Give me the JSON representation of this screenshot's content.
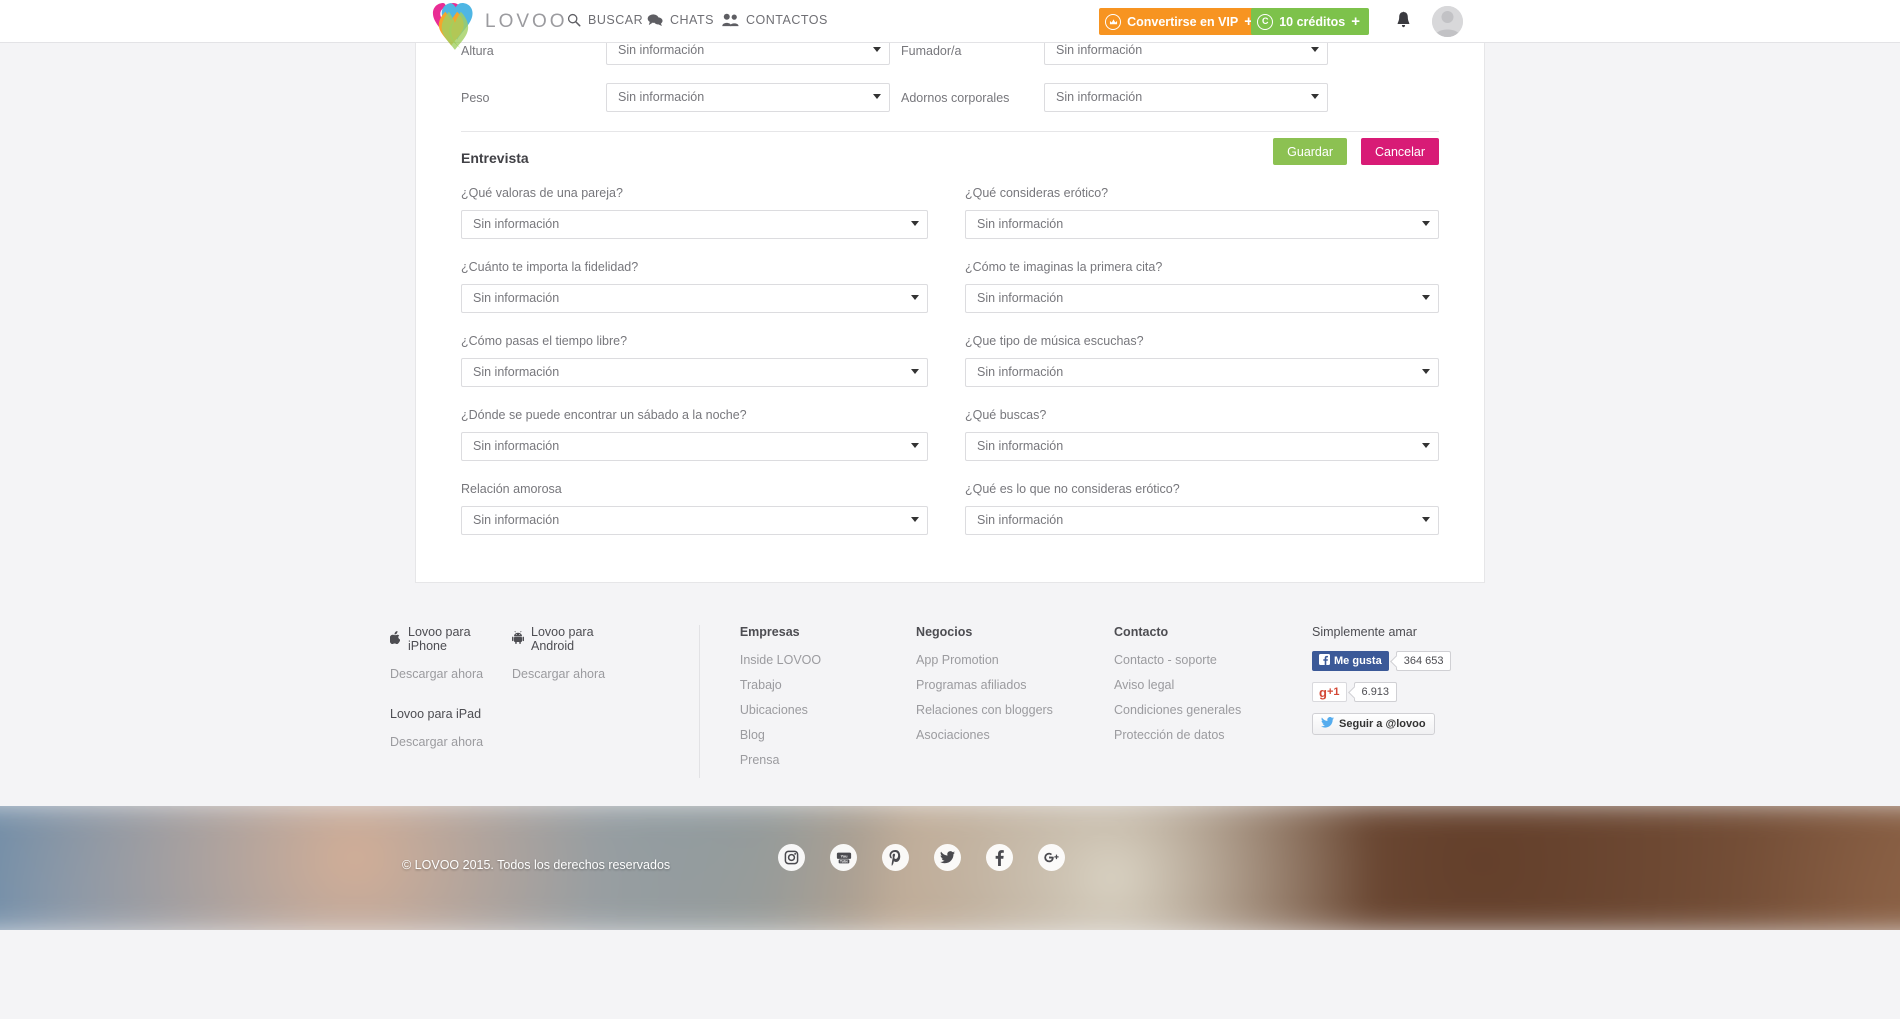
{
  "header": {
    "brand": "LOVOO",
    "nav": [
      {
        "label": "BUSCAR",
        "icon": "search-icon"
      },
      {
        "label": "CHATS",
        "icon": "chat-icon"
      },
      {
        "label": "CONTACTOS",
        "icon": "contacts-icon"
      }
    ],
    "vip_button": {
      "label": "Convertirse en VIP",
      "plus": "+",
      "color": "#f79421"
    },
    "credits_button": {
      "label": "10 créditos",
      "badge": "C",
      "plus": "+",
      "color": "#7dc24b"
    },
    "bell": "notifications-bell",
    "avatar": "user-avatar"
  },
  "top_fields": [
    {
      "label": "Altura",
      "value": "Sin información"
    },
    {
      "label": "Fumador/a",
      "value": "Sin información"
    },
    {
      "label": "Peso",
      "value": "Sin información"
    },
    {
      "label": "Adornos corporales",
      "value": "Sin información"
    }
  ],
  "interview": {
    "title": "Entrevista",
    "save_label": "Guardar",
    "cancel_label": "Cancelar",
    "save_color": "#8cc152",
    "cancel_color": "#d81b76",
    "placeholder": "Sin información",
    "questions": [
      {
        "label": "¿Qué valoras de una pareja?",
        "value": "Sin información"
      },
      {
        "label": "¿Qué consideras erótico?",
        "value": "Sin información"
      },
      {
        "label": "¿Cuánto te importa la fidelidad?",
        "value": "Sin información"
      },
      {
        "label": "¿Cómo te imaginas la primera cita?",
        "value": "Sin información"
      },
      {
        "label": "¿Cómo pasas el tiempo libre?",
        "value": "Sin información"
      },
      {
        "label": "¿Que tipo de música escuchas?",
        "value": "Sin información"
      },
      {
        "label": "¿Dónde se puede encontrar un sábado a la noche?",
        "value": "Sin información"
      },
      {
        "label": "¿Qué buscas?",
        "value": "Sin información"
      },
      {
        "label": "Relación amorosa",
        "value": "Sin información"
      },
      {
        "label": "¿Qué es lo que no consideras erótico?",
        "value": "Sin información"
      }
    ]
  },
  "footer": {
    "apps": {
      "iphone": {
        "title": "Lovoo para iPhone",
        "sub": "Descargar ahora",
        "icon": "apple-icon"
      },
      "android": {
        "title": "Lovoo para Android",
        "sub": "Descargar ahora",
        "icon": "android-icon"
      },
      "ipad": {
        "title": "Lovoo para iPad",
        "sub": "Descargar ahora"
      }
    },
    "columns": [
      {
        "title": "Empresas",
        "links": [
          "Inside LOVOO",
          "Trabajo",
          "Ubicaciones",
          "Blog",
          "Prensa"
        ]
      },
      {
        "title": "Negocios",
        "links": [
          "App Promotion",
          "Programas afiliados",
          "Relaciones con bloggers",
          "Asociaciones"
        ]
      },
      {
        "title": "Contacto",
        "links": [
          "Contacto - soporte",
          "Aviso legal",
          "Condiciones generales",
          "Protección de datos"
        ]
      }
    ],
    "social": {
      "title": "Simplemente amar",
      "facebook": {
        "label": "Me gusta",
        "count": "364 653"
      },
      "googleplus": {
        "label": "+1",
        "count": "6.913"
      },
      "twitter": {
        "label": "Seguir a @lovoo"
      }
    }
  },
  "bottom": {
    "copyright": "© LOVOO 2015. Todos los derechos reservados",
    "socials": [
      "instagram-icon",
      "youtube-icon",
      "pinterest-icon",
      "twitter-icon",
      "facebook-icon",
      "googleplus-icon"
    ]
  }
}
